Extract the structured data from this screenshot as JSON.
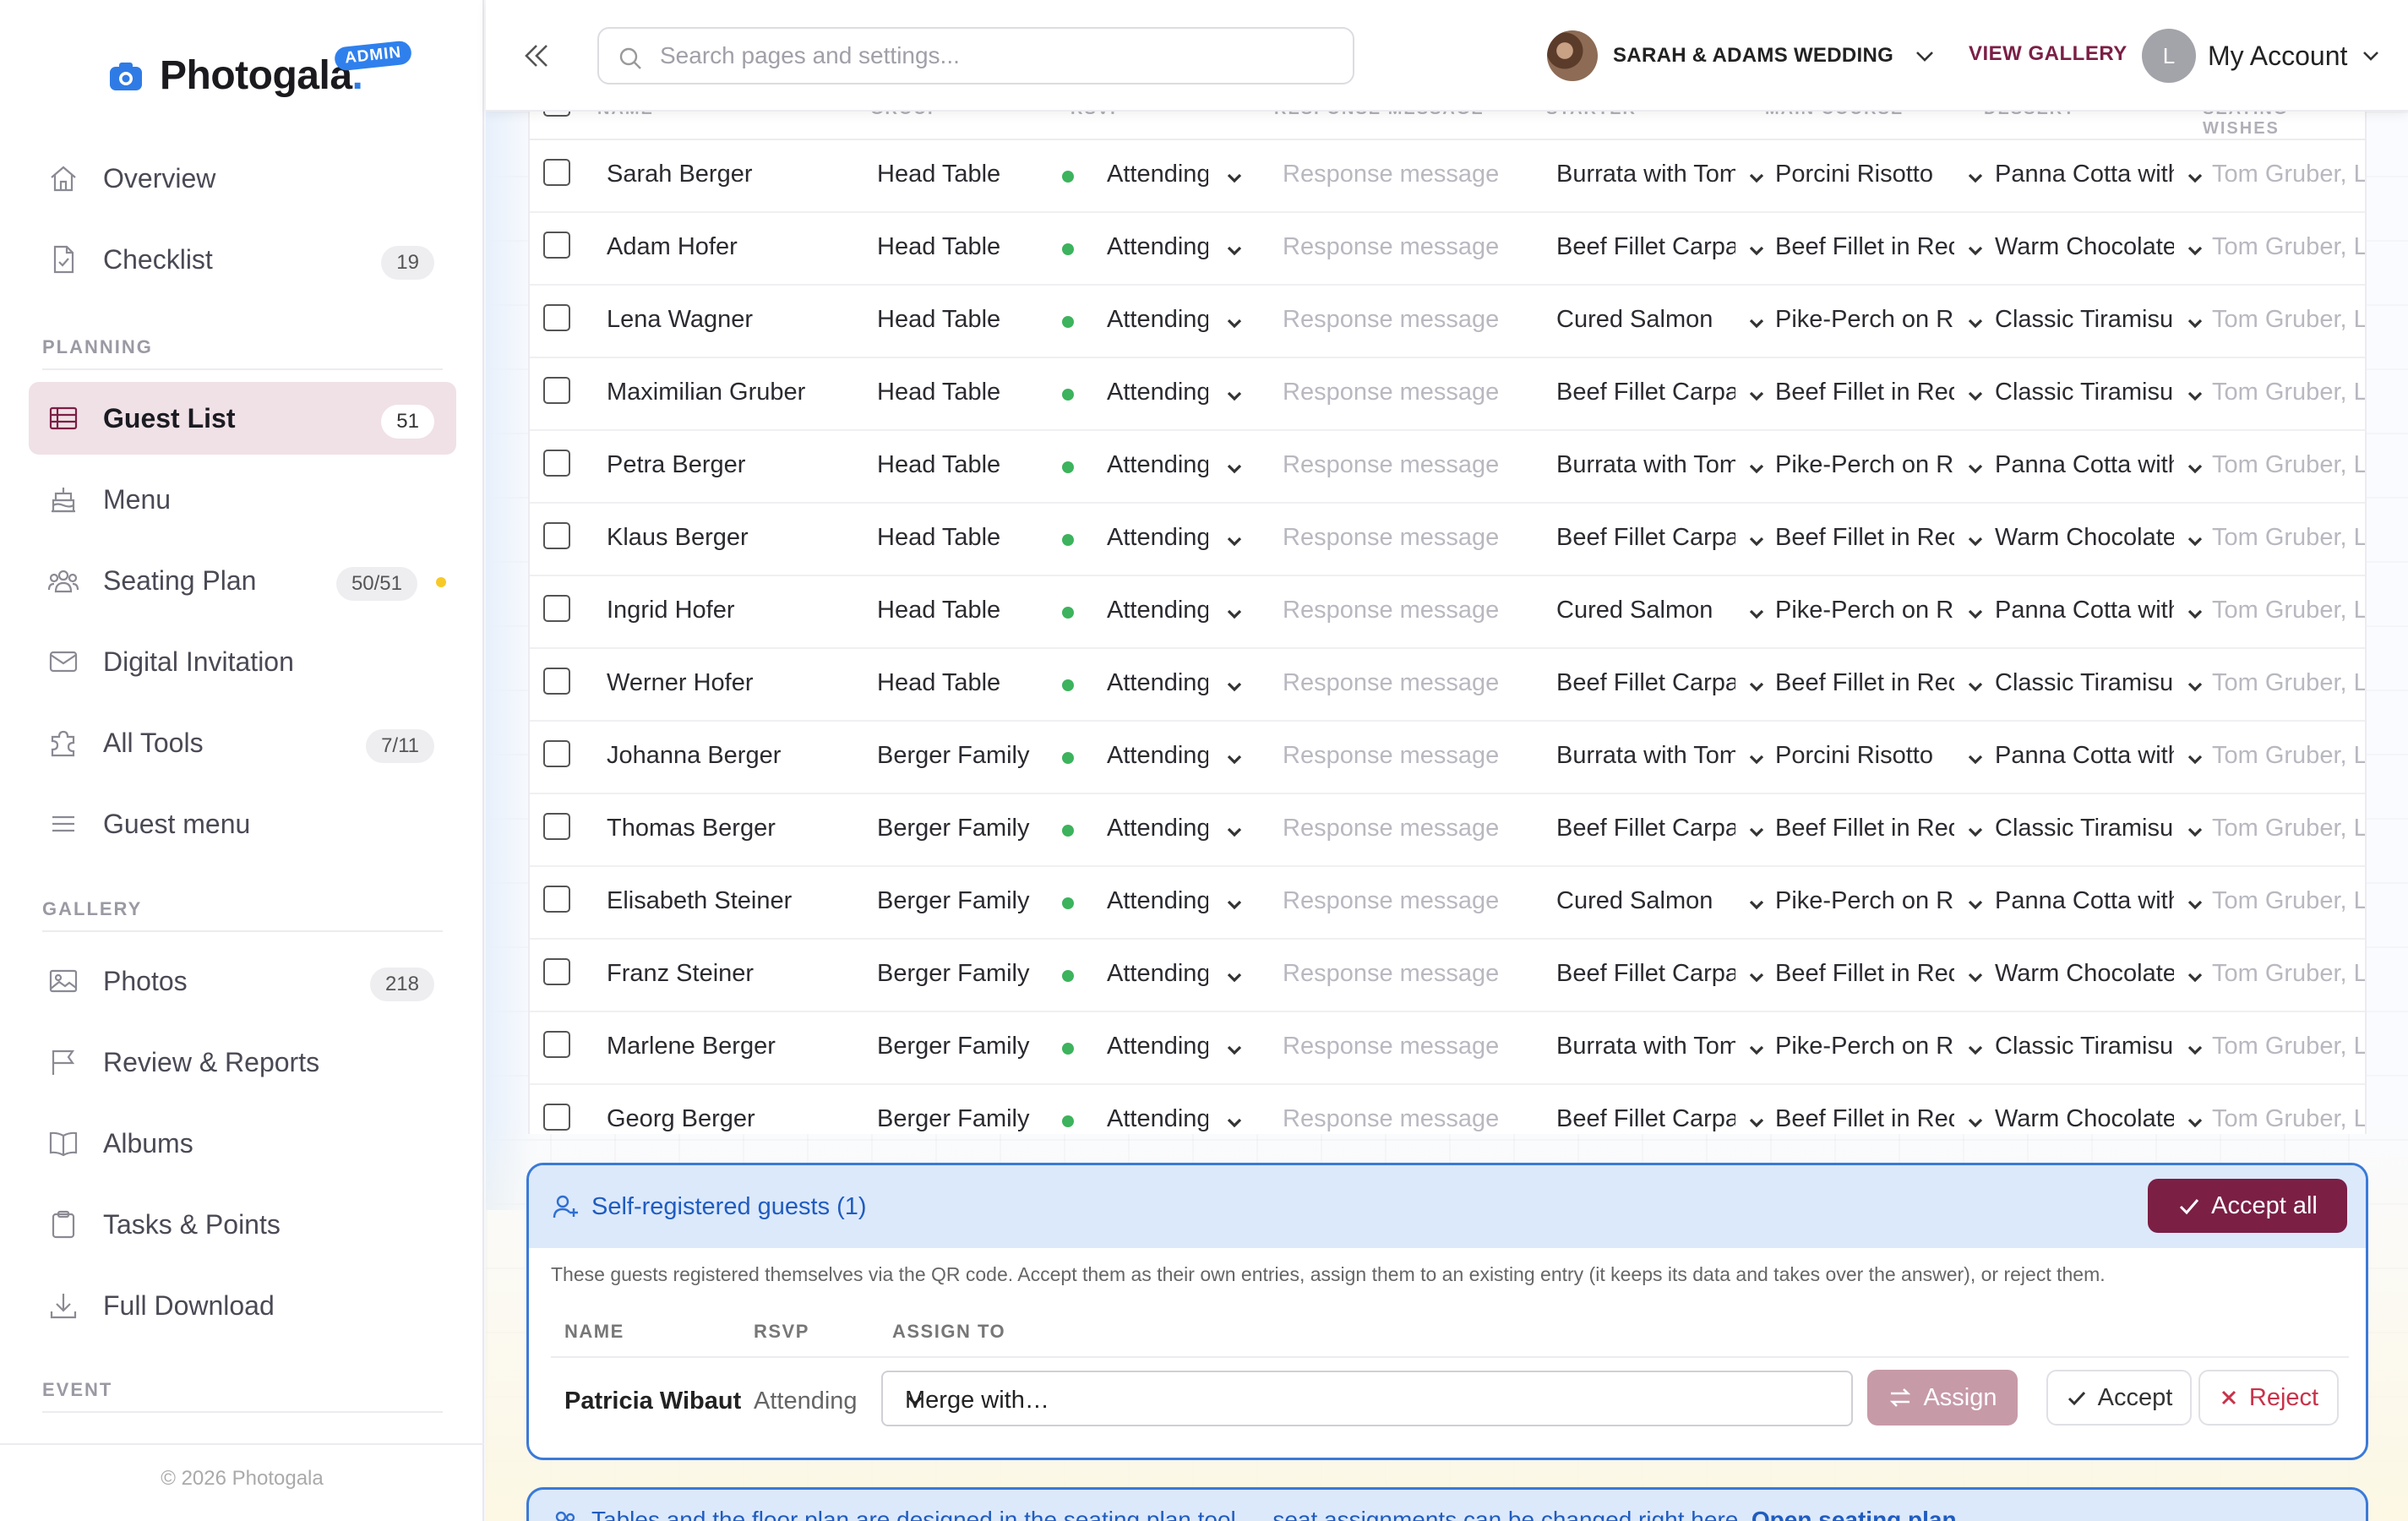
{
  "brand": {
    "name": "Photogala",
    "dot": ".",
    "admin_badge": "ADMIN"
  },
  "sidebar": {
    "overview": "Overview",
    "checklist": {
      "label": "Checklist",
      "badge": "19"
    },
    "planning_label": "PLANNING",
    "guest_list": {
      "label": "Guest List",
      "badge": "51"
    },
    "menu": "Menu",
    "seating_plan": {
      "label": "Seating Plan",
      "badge": "50/51"
    },
    "digital_invitation": "Digital Invitation",
    "all_tools": {
      "label": "All Tools",
      "badge": "7/11"
    },
    "guest_menu": "Guest menu",
    "gallery_label": "GALLERY",
    "photos": {
      "label": "Photos",
      "badge": "218"
    },
    "review_reports": "Review & Reports",
    "albums": "Albums",
    "tasks_points": "Tasks & Points",
    "full_download": "Full Download",
    "event_label": "EVENT",
    "copyright": "© 2026 Photogala"
  },
  "topbar": {
    "search_placeholder": "Search pages and settings...",
    "event_name": "SARAH & ADAMS WEDDING",
    "view_gallery": "VIEW GALLERY",
    "account_initial": "L",
    "account_label": "My Account"
  },
  "table": {
    "headers": [
      "NAME",
      "GROUP",
      "RSVP",
      "RESPONSE MESSAGE",
      "STARTER",
      "MAIN COURSE",
      "DESSERT",
      "SEATING WISHES"
    ],
    "rows": [
      {
        "name": "Sarah Berger",
        "group": "Head Table",
        "rsvp": "Attending",
        "message": "Response message",
        "starter": "Burrata with Tomato",
        "main": "Porcini Risotto",
        "dessert": "Panna Cotta with Berries",
        "seating": "Tom Gruber, Lisa"
      },
      {
        "name": "Adam Hofer",
        "group": "Head Table",
        "rsvp": "Attending",
        "message": "Response message",
        "starter": "Beef Fillet Carpaccio",
        "main": "Beef Fillet in Red Wine",
        "dessert": "Warm Chocolate Cake",
        "seating": "Tom Gruber, Lisa"
      },
      {
        "name": "Lena Wagner",
        "group": "Head Table",
        "rsvp": "Attending",
        "message": "Response message",
        "starter": "Cured Salmon",
        "main": "Pike-Perch on Risotto",
        "dessert": "Classic Tiramisu",
        "seating": "Tom Gruber, Lisa"
      },
      {
        "name": "Maximilian Gruber",
        "group": "Head Table",
        "rsvp": "Attending",
        "message": "Response message",
        "starter": "Beef Fillet Carpaccio",
        "main": "Beef Fillet in Red Wine",
        "dessert": "Classic Tiramisu",
        "seating": "Tom Gruber, Lisa"
      },
      {
        "name": "Petra Berger",
        "group": "Head Table",
        "rsvp": "Attending",
        "message": "Response message",
        "starter": "Burrata with Tomato",
        "main": "Pike-Perch on Risotto",
        "dessert": "Panna Cotta with Berries",
        "seating": "Tom Gruber, Lisa"
      },
      {
        "name": "Klaus Berger",
        "group": "Head Table",
        "rsvp": "Attending",
        "message": "Response message",
        "starter": "Beef Fillet Carpaccio",
        "main": "Beef Fillet in Red Wine",
        "dessert": "Warm Chocolate Cake",
        "seating": "Tom Gruber, Lisa"
      },
      {
        "name": "Ingrid Hofer",
        "group": "Head Table",
        "rsvp": "Attending",
        "message": "Response message",
        "starter": "Cured Salmon",
        "main": "Pike-Perch on Risotto",
        "dessert": "Panna Cotta with Berries",
        "seating": "Tom Gruber, Lisa"
      },
      {
        "name": "Werner Hofer",
        "group": "Head Table",
        "rsvp": "Attending",
        "message": "Response message",
        "starter": "Beef Fillet Carpaccio",
        "main": "Beef Fillet in Red Wine",
        "dessert": "Classic Tiramisu",
        "seating": "Tom Gruber, Lisa"
      },
      {
        "name": "Johanna Berger",
        "group": "Berger Family",
        "rsvp": "Attending",
        "message": "Response message",
        "starter": "Burrata with Tomato",
        "main": "Porcini Risotto",
        "dessert": "Panna Cotta with Berries",
        "seating": "Tom Gruber, Lisa"
      },
      {
        "name": "Thomas Berger",
        "group": "Berger Family",
        "rsvp": "Attending",
        "message": "Response message",
        "starter": "Beef Fillet Carpaccio",
        "main": "Beef Fillet in Red Wine",
        "dessert": "Classic Tiramisu",
        "seating": "Tom Gruber, Lisa"
      },
      {
        "name": "Elisabeth Steiner",
        "group": "Berger Family",
        "rsvp": "Attending",
        "message": "Response message",
        "starter": "Cured Salmon",
        "main": "Pike-Perch on Risotto",
        "dessert": "Panna Cotta with Berries",
        "seating": "Tom Gruber, Lisa"
      },
      {
        "name": "Franz Steiner",
        "group": "Berger Family",
        "rsvp": "Attending",
        "message": "Response message",
        "starter": "Beef Fillet Carpaccio",
        "main": "Beef Fillet in Red Wine",
        "dessert": "Warm Chocolate Cake",
        "seating": "Tom Gruber, Lisa"
      },
      {
        "name": "Marlene Berger",
        "group": "Berger Family",
        "rsvp": "Attending",
        "message": "Response message",
        "starter": "Burrata with Tomato",
        "main": "Pike-Perch on Risotto",
        "dessert": "Classic Tiramisu",
        "seating": "Tom Gruber, Lisa"
      },
      {
        "name": "Georg Berger",
        "group": "Berger Family",
        "rsvp": "Attending",
        "message": "Response message",
        "starter": "Beef Fillet Carpaccio",
        "main": "Beef Fillet in Red Wine",
        "dessert": "Warm Chocolate Cake",
        "seating": "Tom Gruber, Lisa"
      }
    ]
  },
  "selfreg": {
    "title": "Self-registered guests (1)",
    "accept_all": "Accept all",
    "description": "These guests registered themselves via the QR code. Accept them as their own entries, assign them to an existing entry (it keeps its data and takes over the answer), or reject them.",
    "col_name": "NAME",
    "col_rsvp": "RSVP",
    "col_assign": "ASSIGN TO",
    "guest_name": "Patricia Wibaut",
    "guest_rsvp": "Attending",
    "merge_value": "Merge with…",
    "assign": "Assign",
    "accept": "Accept",
    "reject": "Reject"
  },
  "info": {
    "text": "Tables and the floor plan are designed in the seating plan tool — seat assignments can be changed right here.",
    "link": "Open seating plan"
  },
  "colors": {
    "accent": "#7b1f45",
    "brand_blue": "#2f7be6",
    "attending": "#3cb35c",
    "info_blue": "#3a7ad9"
  }
}
